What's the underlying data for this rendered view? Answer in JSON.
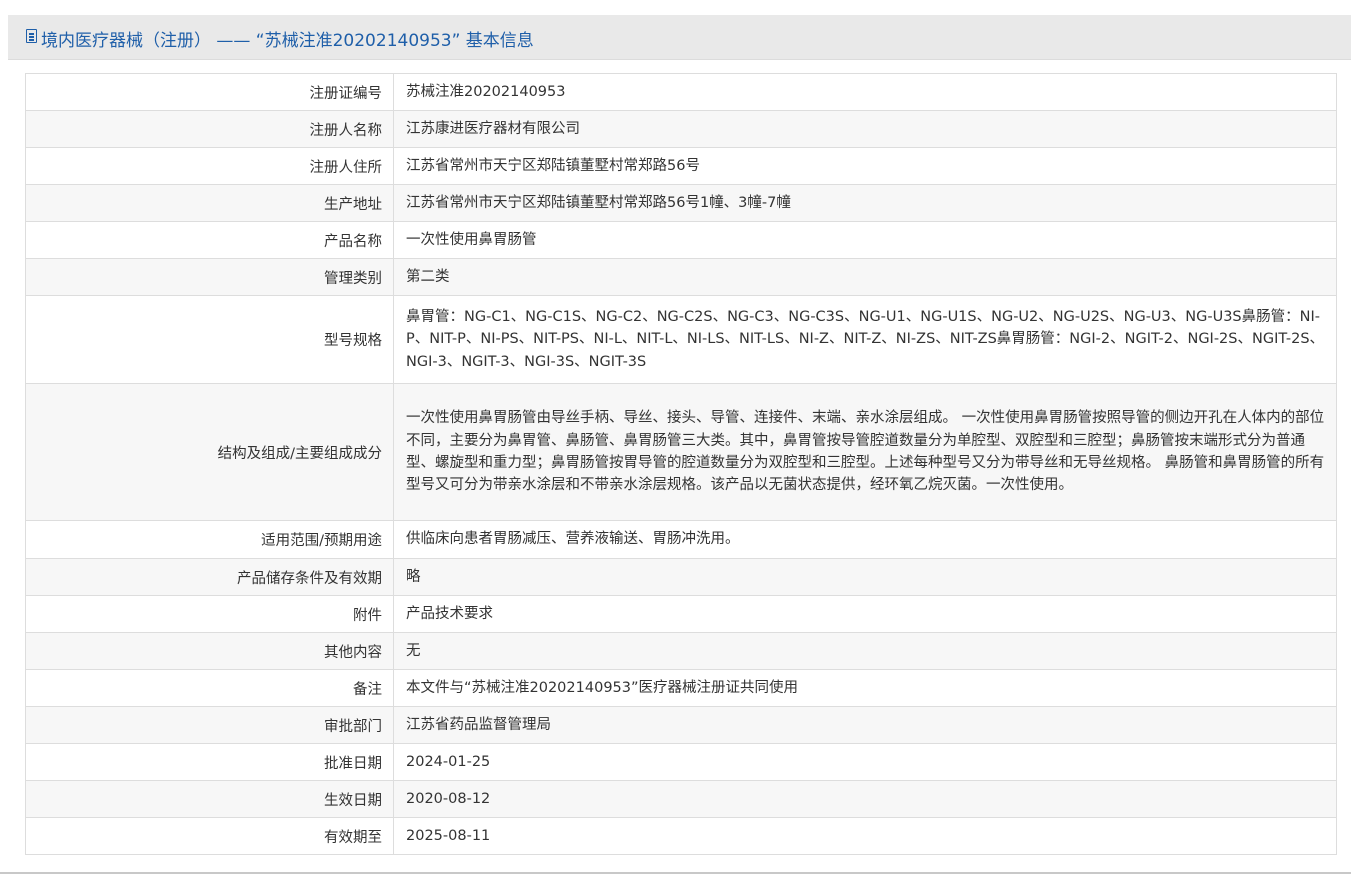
{
  "header": {
    "icon": "document-icon",
    "title": "境内医疗器械（注册） —— “苏械注准20202140953” 基本信息"
  },
  "rows": [
    {
      "label": "注册证编号",
      "value": "苏械注准20202140953"
    },
    {
      "label": "注册人名称",
      "value": "江苏康进医疗器材有限公司"
    },
    {
      "label": "注册人住所",
      "value": "江苏省常州市天宁区郑陆镇董墅村常郑路56号"
    },
    {
      "label": "生产地址",
      "value": "江苏省常州市天宁区郑陆镇董墅村常郑路56号1幢、3幢-7幢"
    },
    {
      "label": "产品名称",
      "value": "一次性使用鼻胃肠管"
    },
    {
      "label": "管理类别",
      "value": "第二类"
    },
    {
      "label": "型号规格",
      "value": "鼻胃管：NG-C1、NG-C1S、NG-C2、NG-C2S、NG-C3、NG-C3S、NG-U1、NG-U1S、NG-U2、NG-U2S、NG-U3、NG-U3S鼻肠管：NI-P、NIT-P、NI-PS、NIT-PS、NI-L、NIT-L、NI-LS、NIT-LS、NI-Z、NIT-Z、NI-ZS、NIT-ZS鼻胃肠管：NGI-2、NGIT-2、NGI-2S、NGIT-2S、NGI-3、NGIT-3、NGI-3S、NGIT-3S"
    },
    {
      "label": "结构及组成/主要组成成分",
      "value": "一次性使用鼻胃肠管由导丝手柄、导丝、接头、导管、连接件、末端、亲水涂层组成。 一次性使用鼻胃肠管按照导管的侧边开孔在人体内的部位不同，主要分为鼻胃管、鼻肠管、鼻胃肠管三大类。其中，鼻胃管按导管腔道数量分为单腔型、双腔型和三腔型；鼻肠管按末端形式分为普通型、螺旋型和重力型；鼻胃肠管按胃导管的腔道数量分为双腔型和三腔型。上述每种型号又分为带导丝和无导丝规格。 鼻肠管和鼻胃肠管的所有型号又可分为带亲水涂层和不带亲水涂层规格。该产品以无菌状态提供，经环氧乙烷灭菌。一次性使用。"
    },
    {
      "label": "适用范围/预期用途",
      "value": "供临床向患者胃肠减压、营养液输送、胃肠冲洗用。"
    },
    {
      "label": "产品储存条件及有效期",
      "value": "略"
    },
    {
      "label": "附件",
      "value": "产品技术要求"
    },
    {
      "label": "其他内容",
      "value": "无"
    },
    {
      "label": "备注",
      "value": "本文件与“苏械注准20202140953”医疗器械注册证共同使用"
    },
    {
      "label": "审批部门",
      "value": "江苏省药品监督管理局"
    },
    {
      "label": "批准日期",
      "value": "2024-01-25"
    },
    {
      "label": "生效日期",
      "value": "2020-08-12"
    },
    {
      "label": "有效期至",
      "value": "2025-08-11"
    }
  ],
  "colors": {
    "title": "#1f5fa9",
    "header_bg": "#e9e9e9",
    "row_alt_bg": "#f7f7f7",
    "border": "#dddddd"
  }
}
